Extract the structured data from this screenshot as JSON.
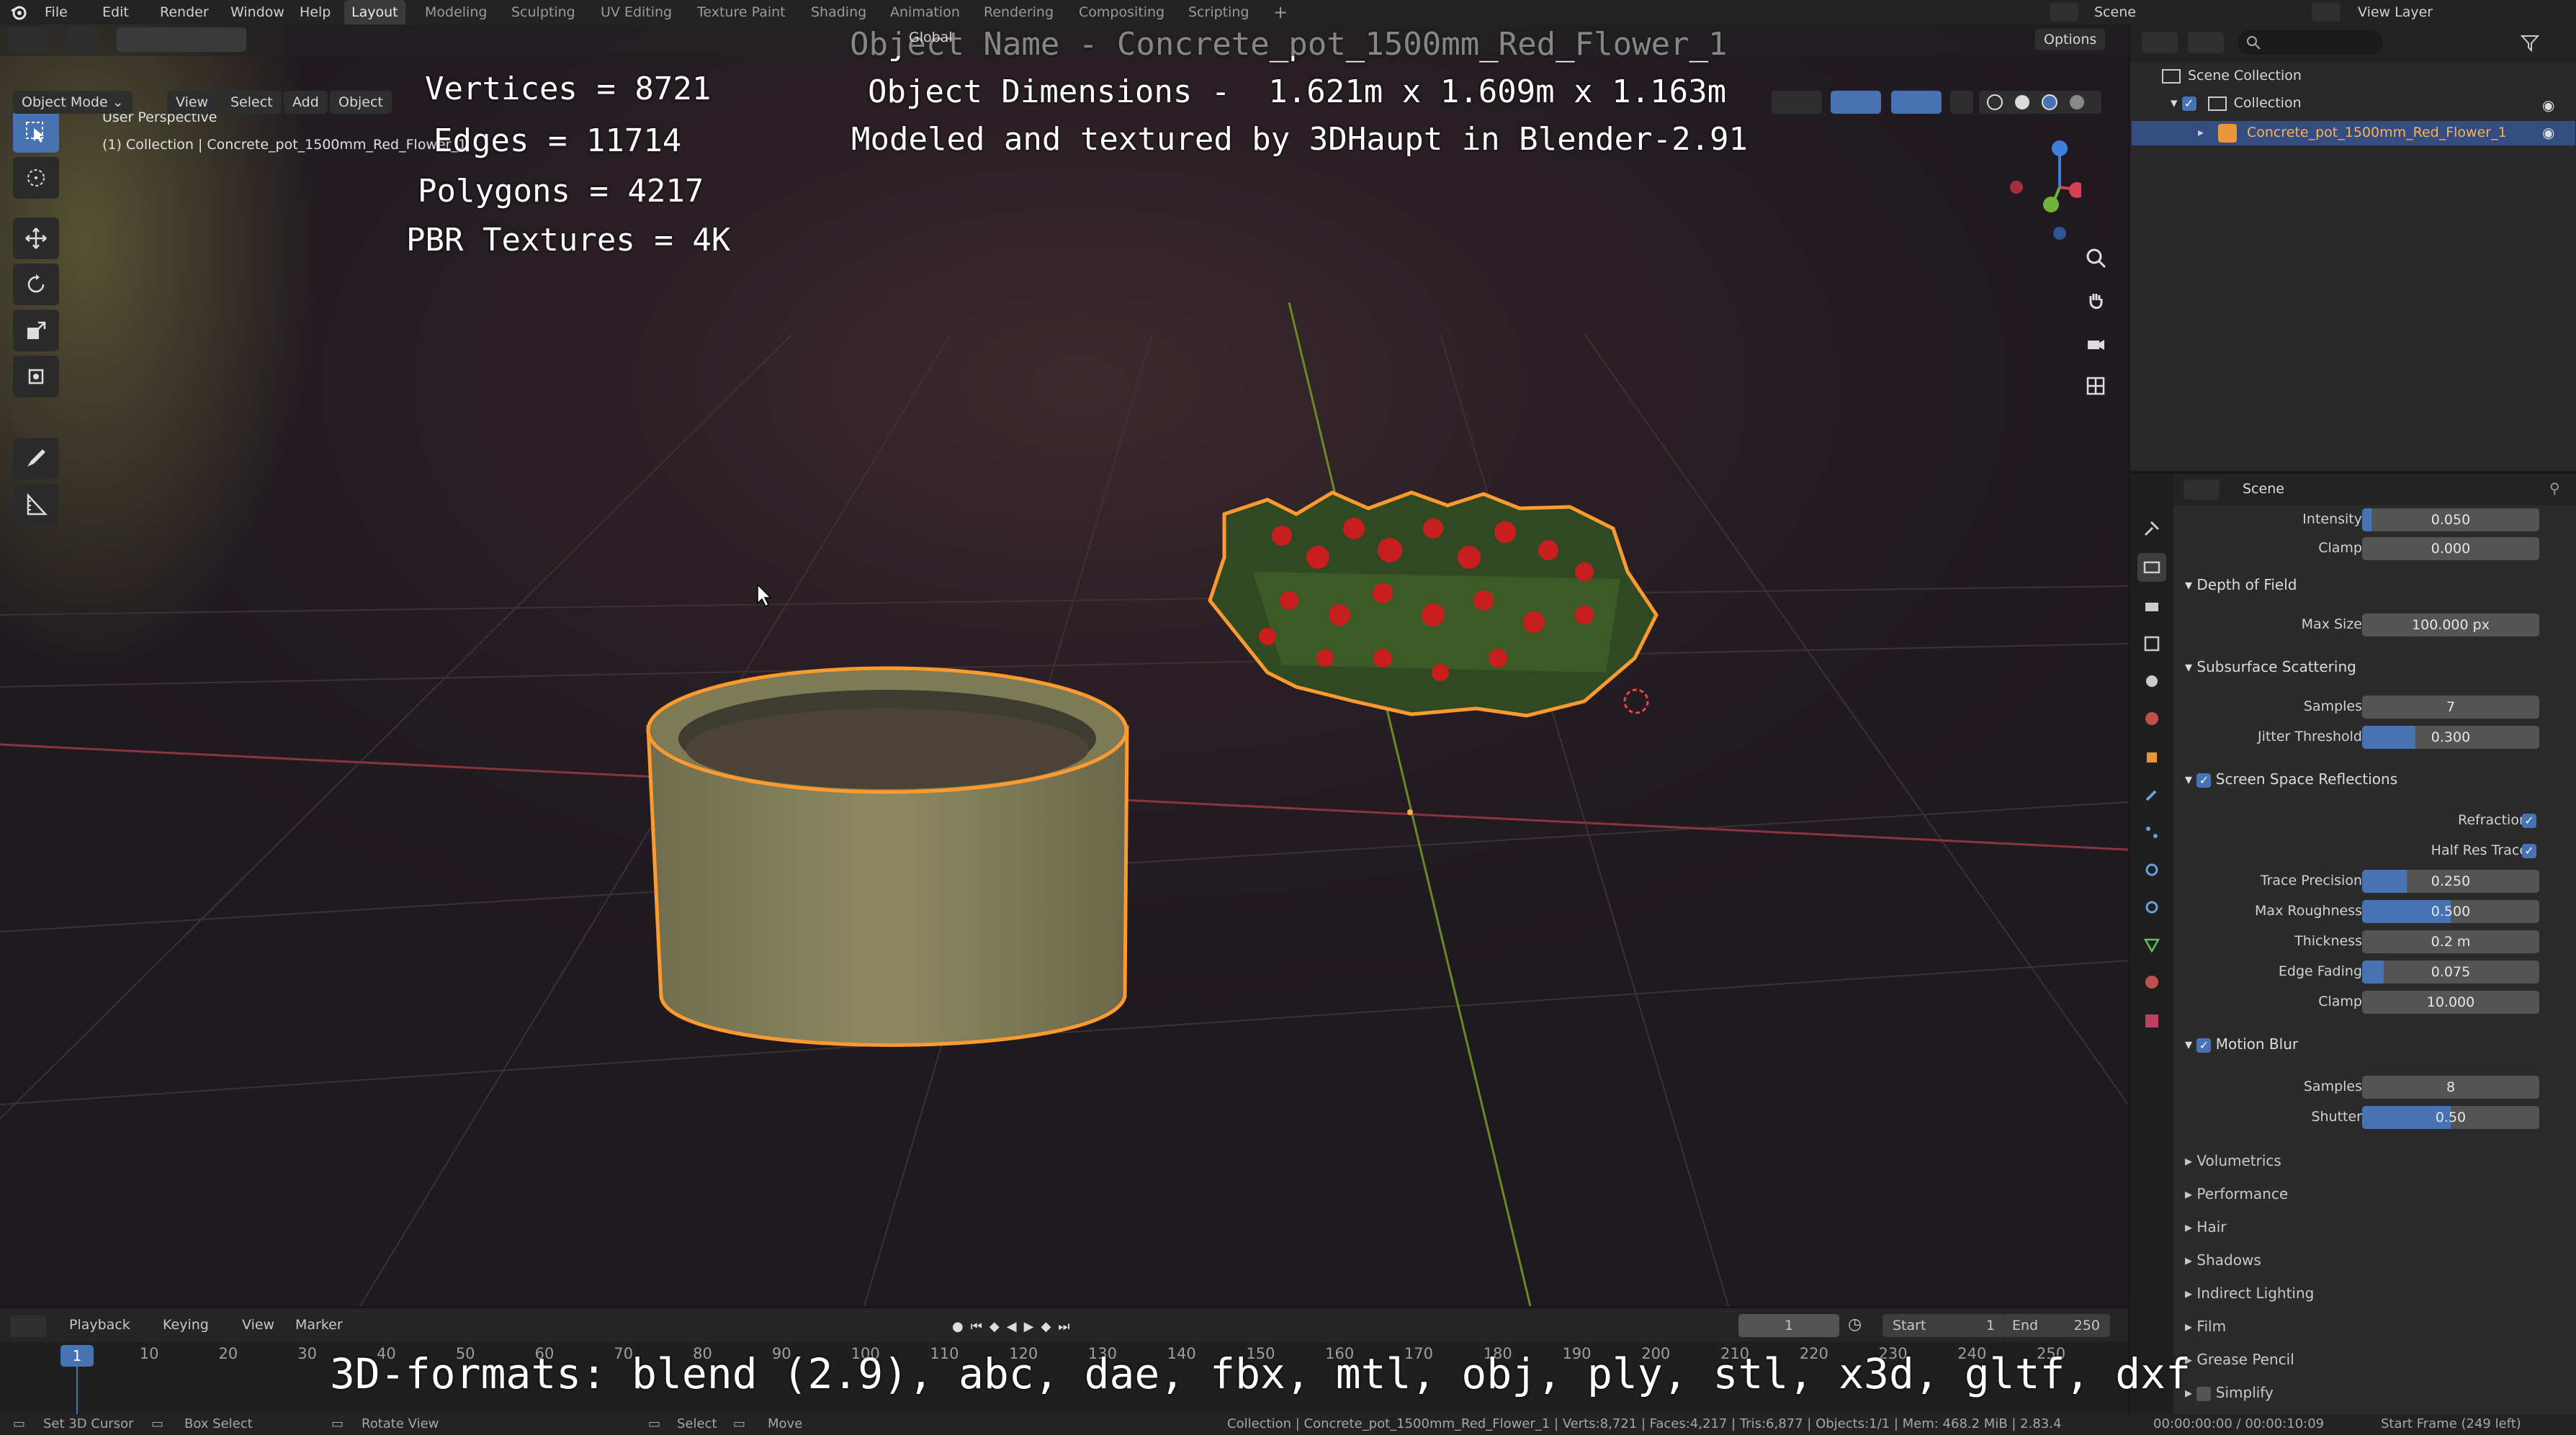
{
  "menus": [
    "File",
    "Edit",
    "Render",
    "Window",
    "Help"
  ],
  "workspace_tabs": [
    "Layout",
    "Modeling",
    "Sculpting",
    "UV Editing",
    "Texture Paint",
    "Shading",
    "Animation",
    "Rendering",
    "Compositing",
    "Scripting"
  ],
  "active_tab": "Layout",
  "scene_label": "Scene",
  "view_layer_label": "View Layer",
  "viewport_header": {
    "mode": "Object Mode",
    "menu": [
      "View",
      "Select",
      "Add",
      "Object"
    ],
    "transform_orientation": "Global",
    "options": "Options"
  },
  "viewport_info": {
    "perspective": "User Perspective",
    "collection": "(1) Collection | Concrete_pot_1500mm_Red_Flower_1"
  },
  "overlay": {
    "object_name": "Object Name - Concrete_pot_1500mm_Red_Flower_1",
    "dimensions": "Object Dimensions -  1.621m x 1.609m x 1.163m",
    "credit": "Modeled and textured by 3DHaupt in Blender-2.91",
    "vertices": "Vertices = 8721",
    "edges": "Edges = 11714",
    "polygons": "Polygons = 4217",
    "textures": "PBR Textures = 4K",
    "formats": "3D-formats: blend (2.9), abc, dae, fbx, mtl, obj, ply, stl, x3d, gltf, dxf"
  },
  "outliner": {
    "scene_collection": "Scene Collection",
    "collection": "Collection",
    "object": "Concrete_pot_1500mm_Red_Flower_1"
  },
  "properties": {
    "context": "Scene",
    "top_rows": [
      {
        "label": "Intensity",
        "value": "0.050",
        "fill": 0.05
      },
      {
        "label": "Clamp",
        "value": "0.000",
        "fill": 0
      }
    ],
    "depth_of_field": {
      "title": "Depth of Field",
      "rows": [
        {
          "label": "Max Size",
          "value": "100.000 px",
          "fill": 0
        }
      ]
    },
    "subsurface": {
      "title": "Subsurface Scattering",
      "rows": [
        {
          "label": "Samples",
          "value": "7",
          "fill": 0
        },
        {
          "label": "Jitter Threshold",
          "value": "0.300",
          "fill": 0.3
        }
      ]
    },
    "ssr": {
      "title": "Screen Space Reflections",
      "checks": [
        {
          "label": "Refraction",
          "checked": true
        },
        {
          "label": "Half Res Trace",
          "checked": true
        }
      ],
      "rows": [
        {
          "label": "Trace Precision",
          "value": "0.250",
          "fill": 0.25
        },
        {
          "label": "Max Roughness",
          "value": "0.500",
          "fill": 0.5
        },
        {
          "label": "Thickness",
          "value": "0.2 m",
          "fill": 0
        },
        {
          "label": "Edge Fading",
          "value": "0.075",
          "fill": 0.075
        },
        {
          "label": "Clamp",
          "value": "10.000",
          "fill": 0
        }
      ]
    },
    "motion_blur": {
      "title": "Motion Blur",
      "rows": [
        {
          "label": "Samples",
          "value": "8",
          "fill": 0
        },
        {
          "label": "Shutter",
          "value": "0.50",
          "fill": 0.5
        }
      ]
    },
    "collapsed": [
      "Volumetrics",
      "Performance",
      "Hair",
      "Shadows",
      "Indirect Lighting",
      "Film",
      "Grease Pencil",
      "Simplify"
    ]
  },
  "timeline": {
    "menu": [
      "Playback",
      "Keying",
      "View",
      "Marker"
    ],
    "current_frame": "1",
    "start_label": "Start",
    "start": "1",
    "end_label": "End",
    "end": "250",
    "ticks": [
      "1",
      "10",
      "20",
      "30",
      "40",
      "50",
      "60",
      "70",
      "80",
      "90",
      "100",
      "110",
      "120",
      "130",
      "140",
      "150",
      "160",
      "170",
      "180",
      "190",
      "200",
      "210",
      "220",
      "230",
      "240",
      "250"
    ]
  },
  "statusbar": {
    "set_cursor": "Set 3D Cursor",
    "box_select": "Box Select",
    "rotate_view": "Rotate View",
    "select": "Select",
    "move": "Move",
    "stats": "Collection | Concrete_pot_1500mm_Red_Flower_1 | Verts:8,721 | Faces:4,217 | Tris:6,877 | Objects:1/1 | Mem: 468.2 MiB | 2.83.4",
    "time": "00:00:00:00 / 00:00:10:09",
    "frames_left": "Start Frame (249 left)"
  }
}
